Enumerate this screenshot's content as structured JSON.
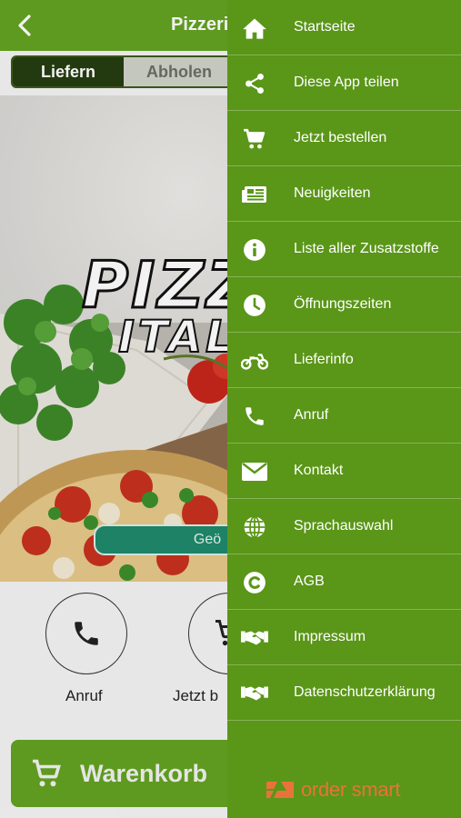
{
  "header": {
    "title": "Pizzeria"
  },
  "segment": {
    "delivery": "Liefern",
    "pickup": "Abholen"
  },
  "hero": {
    "logo_main": "PIZZ",
    "logo_sub": "ITALI",
    "open_status": "Geö"
  },
  "quick_actions": {
    "call_label": "Anruf",
    "order_label": "Jetzt b"
  },
  "cart": {
    "label": "Warenkorb"
  },
  "menu": {
    "items": [
      {
        "label": "Startseite",
        "icon": "home-icon"
      },
      {
        "label": "Diese App teilen",
        "icon": "share-icon"
      },
      {
        "label": "Jetzt bestellen",
        "icon": "cart-icon"
      },
      {
        "label": "Neuigkeiten",
        "icon": "news-icon"
      },
      {
        "label": "Liste aller Zusatzstoffe",
        "icon": "info-icon"
      },
      {
        "label": "Öffnungszeiten",
        "icon": "clock-icon"
      },
      {
        "label": "Lieferinfo",
        "icon": "motorbike-icon"
      },
      {
        "label": "Anruf",
        "icon": "phone-icon"
      },
      {
        "label": "Kontakt",
        "icon": "envelope-icon"
      },
      {
        "label": "Sprachauswahl",
        "icon": "globe-icon"
      },
      {
        "label": "AGB",
        "icon": "copyright-icon"
      },
      {
        "label": "Impressum",
        "icon": "handshake-icon"
      },
      {
        "label": "Datenschutzerklärung",
        "icon": "handshake-icon"
      }
    ]
  },
  "brand": {
    "name": "order smart"
  },
  "colors": {
    "primary": "#64a321",
    "drawer": "#5a9618",
    "brand_orange": "#e8733a",
    "segment_active": "#253d10"
  }
}
